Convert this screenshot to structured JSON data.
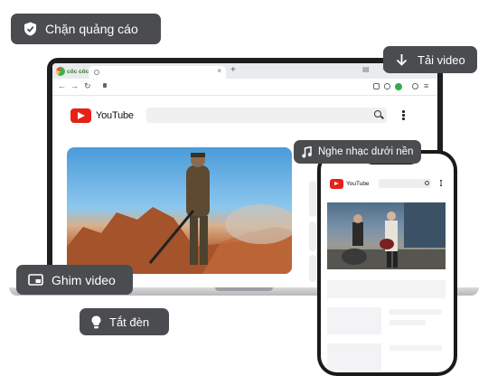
{
  "features": {
    "block_ads": "Chặn quảng cáo",
    "download_video": "Tải video",
    "background_music": "Nghe nhạc dưới nền",
    "pin_video": "Ghim video",
    "lights_off": "Tắt đèn"
  },
  "browser": {
    "brand": "cốc cốc",
    "new_tab_symbol": "+",
    "close_tab_symbol": "×"
  },
  "youtube": {
    "logo_text": "YouTube"
  },
  "phone": {
    "logo_text": "YouTube"
  },
  "icons": [
    "shield-icon",
    "download-arrow-icon",
    "music-note-icon",
    "picture-in-picture-icon",
    "lightbulb-icon",
    "search-icon",
    "more-vertical-icon"
  ],
  "colors": {
    "pill_bg": "#4b4c50",
    "youtube_red": "#e62117",
    "coccoc_green": "#37b34a"
  }
}
